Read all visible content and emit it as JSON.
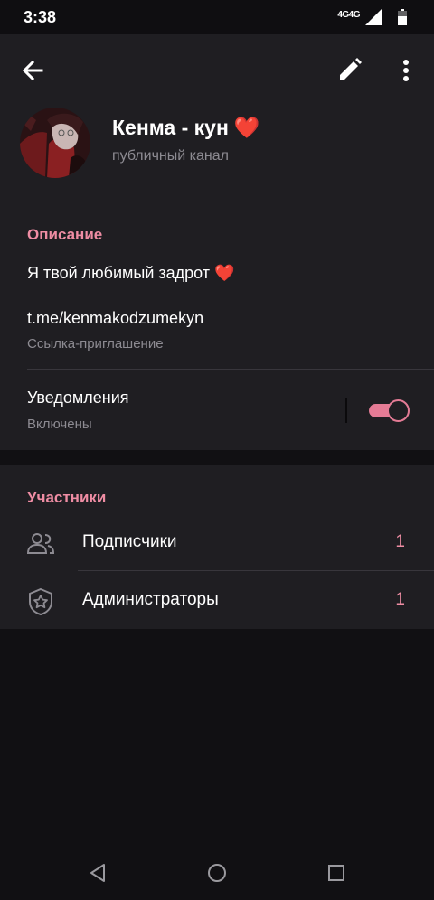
{
  "status_bar": {
    "time": "3:38",
    "network": "4G4G"
  },
  "header": {
    "title": "Кенма - кун",
    "title_emoji": "❤️",
    "subtitle": "публичный канал",
    "icons": [
      "arrow-left-icon",
      "pencil-icon",
      "more-vertical-icon"
    ]
  },
  "info": {
    "section_title": "Описание",
    "description": "Я твой любимый задрот ❤️",
    "invite_link": "t.me/kenmakodzumekyn",
    "invite_link_label": "Ссылка-приглашение",
    "notifications_label": "Уведомления",
    "notifications_status": "Включены",
    "notifications_enabled": true
  },
  "members": {
    "section_title": "Участники",
    "rows": [
      {
        "label": "Подписчики",
        "count": "1",
        "icon": "users-icon"
      },
      {
        "label": "Администраторы",
        "count": "1",
        "icon": "shield-star-icon"
      }
    ]
  },
  "colors": {
    "accent": "#ef8da4",
    "toggle": "#e47b95",
    "card": "#1f1e22",
    "background": "#111013",
    "muted": "#8d8b92"
  }
}
